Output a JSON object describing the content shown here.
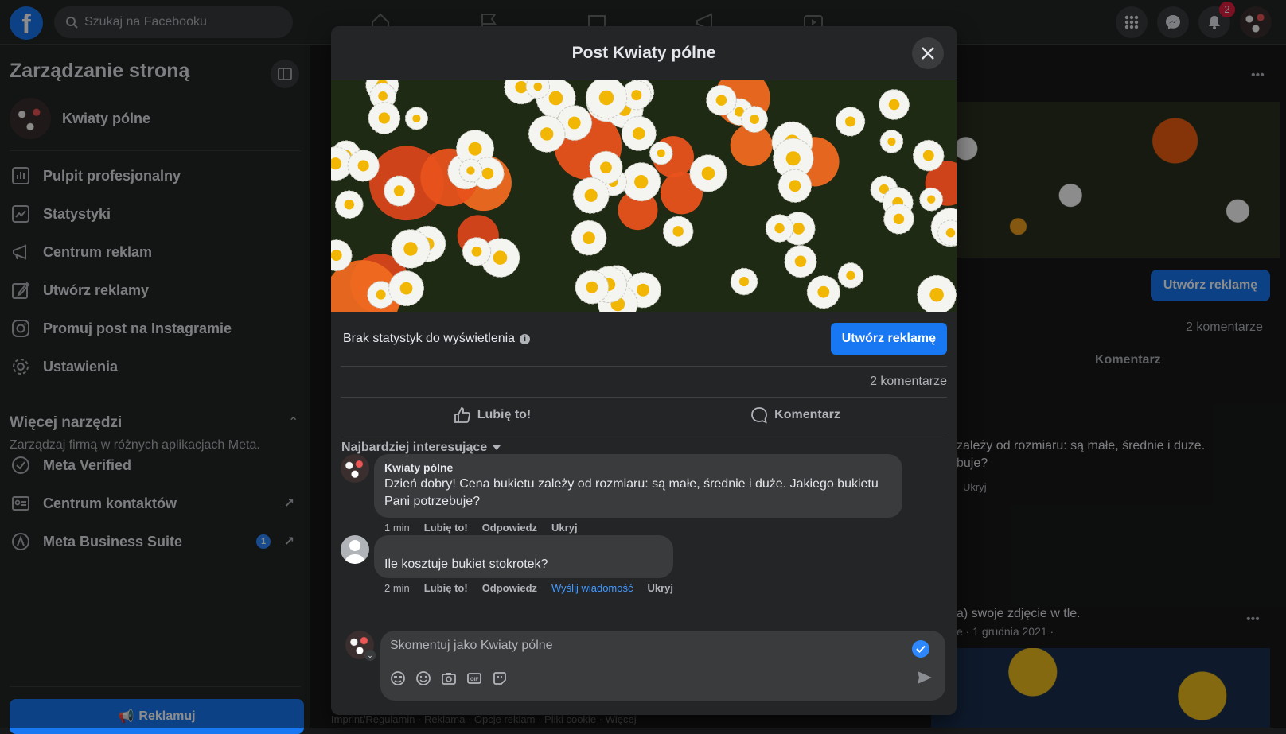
{
  "topbar": {
    "logo": "f",
    "search_placeholder": "Szukaj na Facebooku",
    "notifications_count": "2"
  },
  "sidebar": {
    "title": "Zarządzanie stroną",
    "page_name": "Kwiaty pólne",
    "items": [
      {
        "label": "Pulpit profesjonalny",
        "icon": "dashboard-icon"
      },
      {
        "label": "Statystyki",
        "icon": "insights-icon"
      },
      {
        "label": "Centrum reklam",
        "icon": "megaphone-icon"
      },
      {
        "label": "Utwórz reklamy",
        "icon": "edit-icon"
      },
      {
        "label": "Promuj post na Instagramie",
        "icon": "instagram-icon"
      },
      {
        "label": "Ustawienia",
        "icon": "gear-icon"
      }
    ],
    "more_tools": {
      "title": "Więcej narzędzi",
      "subtitle": "Zarządzaj firmą w różnych aplikacjach Meta."
    },
    "meta_items": [
      {
        "label": "Meta Verified",
        "icon": "verified-icon"
      },
      {
        "label": "Centrum kontaktów",
        "icon": "contacts-icon"
      },
      {
        "label": "Meta Business Suite",
        "icon": "meta-business-icon",
        "count": "1"
      }
    ],
    "promote_label": "Reklamuj"
  },
  "background": {
    "create_ad": "Utwórz reklamę",
    "comments_count": "2 komentarze",
    "comment_action": "Komentarz",
    "comment_snip1": "zależy od rozmiaru: są małe, średnie i duże.",
    "comment_snip2": "buje?",
    "hide": "Ukryj",
    "post2_text": "a) swoje zdjęcie w tle.",
    "post2_date": "e · 1 grudnia 2021 ·",
    "footer": "Imprint/Regulamin · Reklama · Opcje reklam · Pliki cookie · Więcej"
  },
  "modal": {
    "title": "Post Kwiaty pólne",
    "stats_text": "Brak statystyk do wyświetlenia",
    "create_ad": "Utwórz reklamę",
    "comments_count": "2 komentarze",
    "like": "Lubię to!",
    "comment": "Komentarz",
    "sort": "Najbardziej interesujące",
    "comments": [
      {
        "author": "Kwiaty pólne",
        "text": "Dzień dobry! Cena bukietu zależy od rozmiaru: są małe, średnie i duże. Jakiego bukietu Pani potrzebuje?",
        "time": "1 min",
        "like": "Lubię to!",
        "reply": "Odpowiedz",
        "hide": "Ukryj"
      },
      {
        "author": "",
        "text": "Ile kosztuje bukiet stokrotek?",
        "time": "2 min",
        "like": "Lubię to!",
        "reply": "Odpowiedz",
        "message": "Wyślij wiadomość",
        "hide": "Ukryj"
      }
    ],
    "composer_placeholder": "Skomentuj jako Kwiaty pólne"
  },
  "colors": {
    "accent": "#1877f2",
    "link": "#4599ff",
    "surface": "#242526",
    "bubble": "#3a3b3c"
  }
}
